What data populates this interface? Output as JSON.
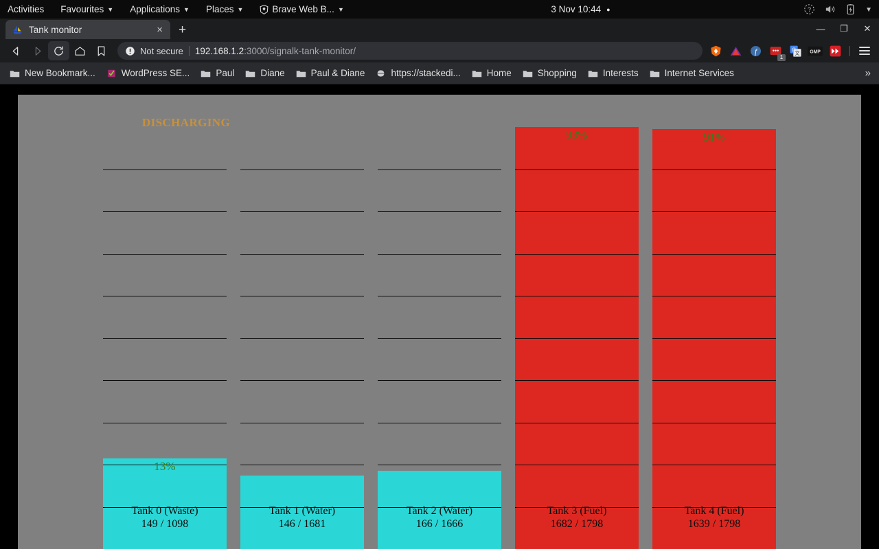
{
  "desktop": {
    "menus": [
      {
        "label": "Activities",
        "caret": false,
        "icon": null
      },
      {
        "label": "Favourites",
        "caret": true,
        "icon": null
      },
      {
        "label": "Applications",
        "caret": true,
        "icon": null
      },
      {
        "label": "Places",
        "caret": true,
        "icon": null
      },
      {
        "label": "Brave Web B...",
        "caret": true,
        "icon": "brave-lion-icon"
      }
    ],
    "clock": "3 Nov  10:44",
    "recording_dot": "●",
    "tray": [
      "help-icon",
      "volume-icon",
      "battery-charging-icon",
      "system-menu-chevron-icon"
    ]
  },
  "browser": {
    "tab": {
      "title": "Tank monitor",
      "favicon": "sailboat-icon",
      "close": "×"
    },
    "new_tab_label": "+",
    "window_controls": {
      "minimize": "—",
      "maximize": "❐",
      "close": "✕"
    },
    "nav": {
      "back": "back-arrow-icon",
      "forward": "forward-arrow-icon",
      "reload": "reload-icon",
      "home": "home-icon",
      "bookmark": "bookmark-icon"
    },
    "omnibox": {
      "security_label": "Not secure",
      "url_host": "192.168.1.2",
      "url_rest": ":3000/signalk-tank-monitor/"
    },
    "extensions": [
      {
        "name": "brave-shields-icon",
        "badge": null
      },
      {
        "name": "triangle-extension-icon",
        "badge": null
      },
      {
        "name": "f-extension-icon",
        "badge": null
      },
      {
        "name": "red-dots-extension-icon",
        "badge": "1"
      },
      {
        "name": "google-translate-icon",
        "badge": null
      },
      {
        "name": "gmp-extension-icon",
        "badge": null
      },
      {
        "name": "fast-forward-extension-icon",
        "badge": null
      }
    ],
    "menu_label": "menu-icon",
    "bookmarks": [
      {
        "label": "New Bookmark...",
        "icon": "folder-icon"
      },
      {
        "label": "WordPress SE...",
        "icon": "yoast-icon"
      },
      {
        "label": "Paul",
        "icon": "folder-icon"
      },
      {
        "label": "Diane",
        "icon": "folder-icon"
      },
      {
        "label": "Paul & Diane",
        "icon": "folder-icon"
      },
      {
        "label": "https://stackedi...",
        "icon": "globe-icon"
      },
      {
        "label": "Home",
        "icon": "folder-icon"
      },
      {
        "label": "Shopping",
        "icon": "folder-icon"
      },
      {
        "label": "Interests",
        "icon": "folder-icon"
      },
      {
        "label": "Internet Services",
        "icon": "folder-icon"
      }
    ],
    "bookmarks_overflow": "»"
  },
  "app": {
    "status": "DISCHARGING",
    "colors": {
      "background": "#808080",
      "fill_low": "#2bd6d6",
      "fill_high": "#dd2821",
      "percent_text": "#3d7a1b",
      "status_text": "#c8913c",
      "tick": "#0c0c0c"
    },
    "tanks": [
      {
        "name": "Tank 0 (Waste)",
        "type": "Waste",
        "percent": 13,
        "percent_label": "13%",
        "current": 149,
        "capacity": 1098,
        "reading": "149 / 1098",
        "fill_color": "#2bd6d6",
        "show_percent": true
      },
      {
        "name": "Tank 1 (Water)",
        "type": "Water",
        "percent": 9,
        "percent_label": "9%",
        "current": 146,
        "capacity": 1681,
        "reading": "146 / 1681",
        "fill_color": "#2bd6d6",
        "show_percent": false
      },
      {
        "name": "Tank 2 (Water)",
        "type": "Water",
        "percent": 10,
        "percent_label": "10%",
        "current": 166,
        "capacity": 1666,
        "reading": "166 / 1666",
        "fill_color": "#2bd6d6",
        "show_percent": false
      },
      {
        "name": "Tank 3 (Fuel)",
        "type": "Fuel",
        "percent": 93,
        "percent_label": "93%",
        "current": 1682,
        "capacity": 1798,
        "reading": "1682 / 1798",
        "fill_color": "#dd2821",
        "show_percent": true
      },
      {
        "name": "Tank 4 (Fuel)",
        "type": "Fuel",
        "percent": 91,
        "percent_label": "91%",
        "current": 1639,
        "capacity": 1798,
        "reading": "1639 / 1798",
        "fill_color": "#dd2821",
        "show_percent": true
      }
    ]
  }
}
